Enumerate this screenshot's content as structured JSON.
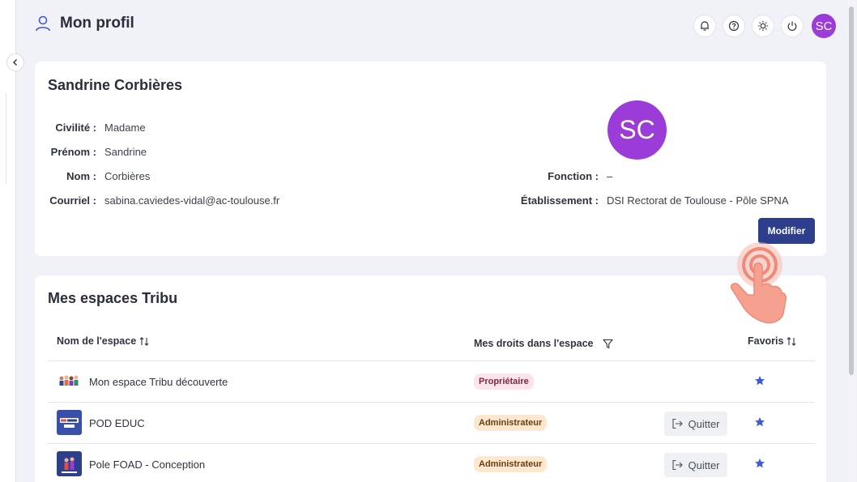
{
  "header": {
    "title": "Mon profil",
    "avatar_initials": "SC"
  },
  "colors": {
    "accent": "#2c3e8c",
    "avatar": "#9b3cd8",
    "owner_badge": "#fde4ea",
    "admin_badge": "#fde7cf",
    "star": "#3d5bd6"
  },
  "icons": [
    "user-icon",
    "bell-icon",
    "help-icon",
    "sun-icon",
    "power-icon",
    "chevron-left-icon",
    "sort-icon",
    "filter-icon",
    "logout-icon",
    "star-icon"
  ],
  "profile": {
    "name": "Sandrine Corbières",
    "avatar_initials": "SC",
    "civilite_label": "Civilité :",
    "civilite_value": "Madame",
    "prenom_label": "Prénom :",
    "prenom_value": "Sandrine",
    "nom_label": "Nom :",
    "nom_value": "Corbières",
    "courriel_label": "Courriel :",
    "courriel_value": "sabina.caviedes-vidal@ac-toulouse.fr",
    "fonction_label": "Fonction :",
    "fonction_value": "–",
    "etablissement_label": "Établissement :",
    "etablissement_value": "DSI Rectorat de Toulouse - Pôle SPNA",
    "modifier_label": "Modifier"
  },
  "spaces": {
    "title": "Mes espaces Tribu",
    "col_name": "Nom de l'espace",
    "col_rights": "Mes droits dans l'espace",
    "col_favorites": "Favoris",
    "rows": [
      {
        "name": "Mon espace Tribu découverte",
        "role": "Propriétaire",
        "quit": ""
      },
      {
        "name": "POD EDUC",
        "role": "Administrateur",
        "quit": "Quitter"
      },
      {
        "name": "Pole FOAD - Conception",
        "role": "Administrateur",
        "quit": "Quitter"
      }
    ]
  }
}
